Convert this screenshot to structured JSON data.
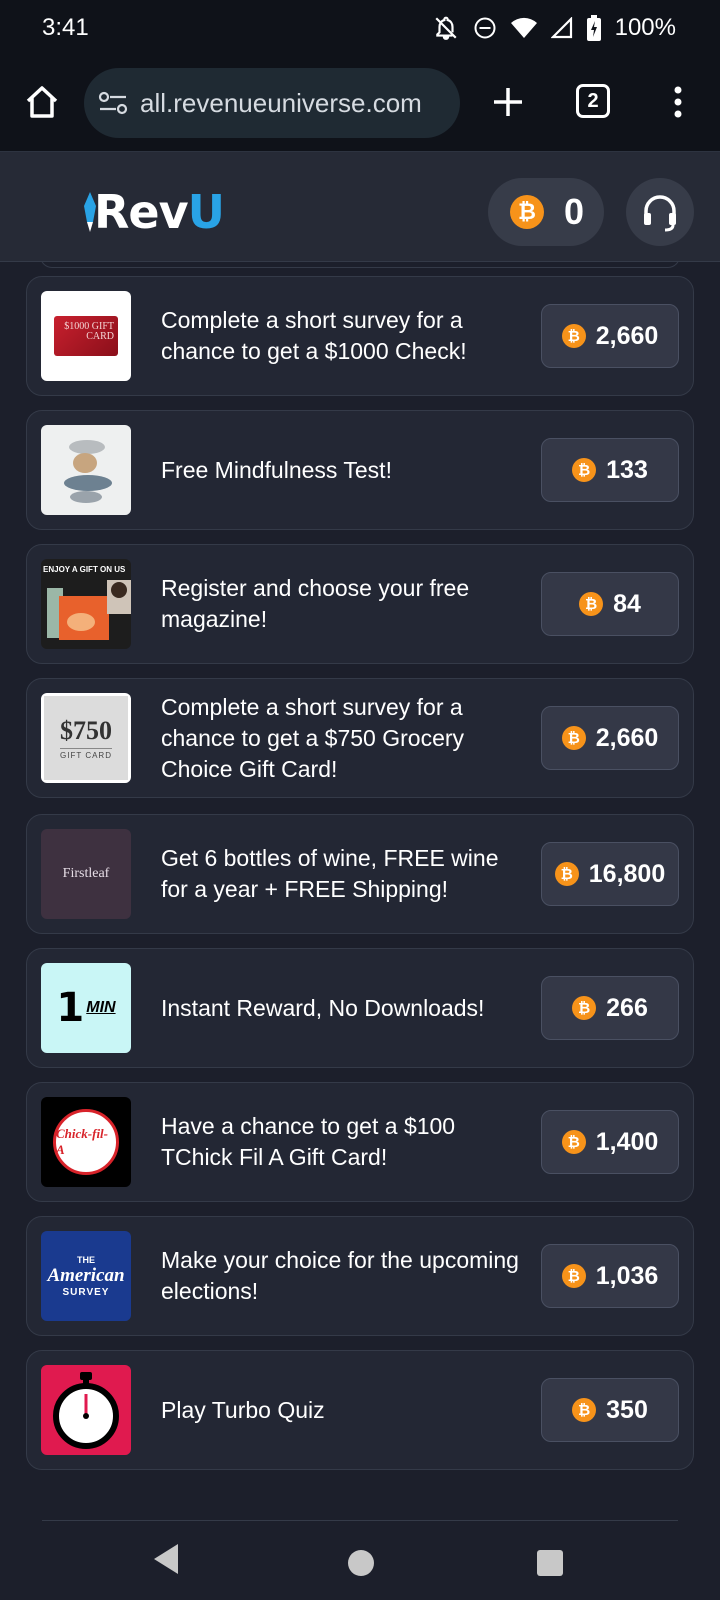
{
  "status_bar": {
    "time": "3:41",
    "battery": "100%"
  },
  "browser": {
    "url": "all.revenueuniverse.com",
    "tab_count": "2"
  },
  "header": {
    "logo_main": "Rev",
    "logo_accent": "U",
    "coin_balance": "0",
    "coin_symbol": "₿"
  },
  "offers": [
    {
      "title": "Complete a short survey for a chance to get a $1000 Check!",
      "reward": "2,660",
      "thumb_text": "$1000 GIFT CARD"
    },
    {
      "title": "Free Mindfulness Test!",
      "reward": "133"
    },
    {
      "title": "Register and choose your free magazine!",
      "reward": "84",
      "thumb_text": "ENJOY A GIFT ON US"
    },
    {
      "title": "Complete a short survey for a chance to get a $750 Grocery Choice Gift Card!",
      "reward": "2,660",
      "thumb_amount": "$750",
      "thumb_label": "GIFT CARD"
    },
    {
      "title": "Get 6 bottles of wine, FREE wine for a year + FREE Shipping!",
      "reward": "16,800",
      "thumb_text": "Firstleaf"
    },
    {
      "title": "Instant Reward, No Downloads!",
      "reward": "266",
      "thumb_one": "1",
      "thumb_min": "MIN"
    },
    {
      "title": "Have a chance to get a $100 TChick Fil A Gift Card!",
      "reward": "1,400",
      "thumb_text": "Chick-fil-A"
    },
    {
      "title": "Make your choice for the upcoming elections!",
      "reward": "1,036",
      "thumb_the": "THE",
      "thumb_american": "American",
      "thumb_survey": "SURVEY"
    },
    {
      "title": "Play Turbo Quiz",
      "reward": "350"
    }
  ],
  "colors": {
    "coin": "#f7931a",
    "accent": "#29a3e6",
    "background": "#1c1f2b",
    "card": "#232734"
  }
}
